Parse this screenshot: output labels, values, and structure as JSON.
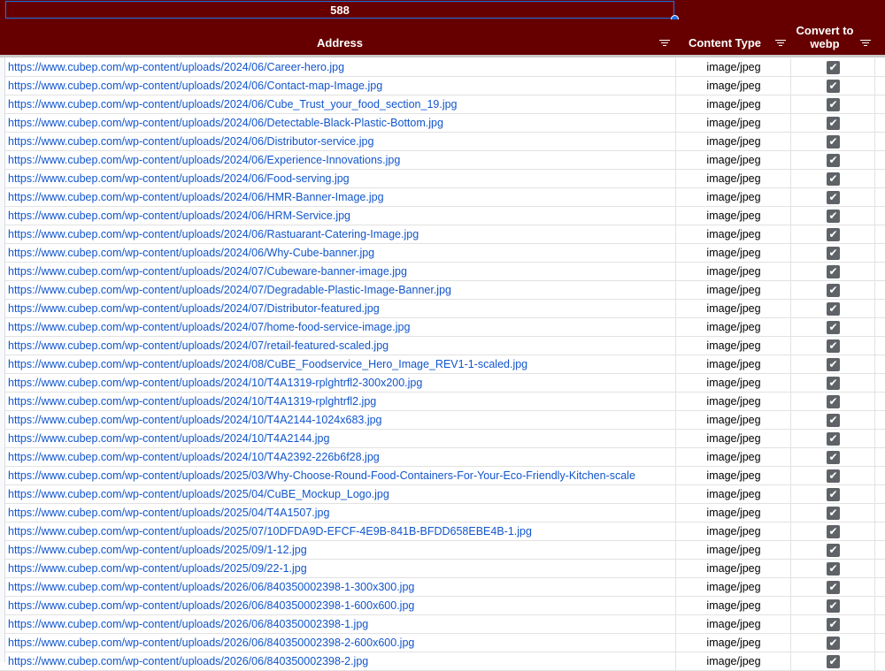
{
  "summary": {
    "count": "588"
  },
  "header": {
    "address": "Address",
    "content_type": "Content Type",
    "convert": "Convert to webp"
  },
  "rows": [
    {
      "address": "https://www.cubep.com/wp-content/uploads/2024/06/Career-hero.jpg",
      "type": "image/jpeg",
      "checked": true
    },
    {
      "address": "https://www.cubep.com/wp-content/uploads/2024/06/Contact-map-Image.jpg",
      "type": "image/jpeg",
      "checked": true
    },
    {
      "address": "https://www.cubep.com/wp-content/uploads/2024/06/Cube_Trust_your_food_section_19.jpg",
      "type": "image/jpeg",
      "checked": true
    },
    {
      "address": "https://www.cubep.com/wp-content/uploads/2024/06/Detectable-Black-Plastic-Bottom.jpg",
      "type": "image/jpeg",
      "checked": true
    },
    {
      "address": "https://www.cubep.com/wp-content/uploads/2024/06/Distributor-service.jpg",
      "type": "image/jpeg",
      "checked": true
    },
    {
      "address": "https://www.cubep.com/wp-content/uploads/2024/06/Experience-Innovations.jpg",
      "type": "image/jpeg",
      "checked": true
    },
    {
      "address": "https://www.cubep.com/wp-content/uploads/2024/06/Food-serving.jpg",
      "type": "image/jpeg",
      "checked": true
    },
    {
      "address": "https://www.cubep.com/wp-content/uploads/2024/06/HMR-Banner-Image.jpg",
      "type": "image/jpeg",
      "checked": true
    },
    {
      "address": "https://www.cubep.com/wp-content/uploads/2024/06/HRM-Service.jpg",
      "type": "image/jpeg",
      "checked": true
    },
    {
      "address": "https://www.cubep.com/wp-content/uploads/2024/06/Rastuarant-Catering-Image.jpg",
      "type": "image/jpeg",
      "checked": true
    },
    {
      "address": "https://www.cubep.com/wp-content/uploads/2024/06/Why-Cube-banner.jpg",
      "type": "image/jpeg",
      "checked": true
    },
    {
      "address": "https://www.cubep.com/wp-content/uploads/2024/07/Cubeware-banner-image.jpg",
      "type": "image/jpeg",
      "checked": true
    },
    {
      "address": "https://www.cubep.com/wp-content/uploads/2024/07/Degradable-Plastic-Image-Banner.jpg",
      "type": "image/jpeg",
      "checked": true
    },
    {
      "address": "https://www.cubep.com/wp-content/uploads/2024/07/Distributor-featured.jpg",
      "type": "image/jpeg",
      "checked": true
    },
    {
      "address": "https://www.cubep.com/wp-content/uploads/2024/07/home-food-service-image.jpg",
      "type": "image/jpeg",
      "checked": true
    },
    {
      "address": "https://www.cubep.com/wp-content/uploads/2024/07/retail-featured-scaled.jpg",
      "type": "image/jpeg",
      "checked": true
    },
    {
      "address": "https://www.cubep.com/wp-content/uploads/2024/08/CuBE_Foodservice_Hero_Image_REV1-1-scaled.jpg",
      "type": "image/jpeg",
      "checked": true
    },
    {
      "address": "https://www.cubep.com/wp-content/uploads/2024/10/T4A1319-rplghtrfl2-300x200.jpg",
      "type": "image/jpeg",
      "checked": true
    },
    {
      "address": "https://www.cubep.com/wp-content/uploads/2024/10/T4A1319-rplghtrfl2.jpg",
      "type": "image/jpeg",
      "checked": true
    },
    {
      "address": "https://www.cubep.com/wp-content/uploads/2024/10/T4A2144-1024x683.jpg",
      "type": "image/jpeg",
      "checked": true
    },
    {
      "address": "https://www.cubep.com/wp-content/uploads/2024/10/T4A2144.jpg",
      "type": "image/jpeg",
      "checked": true
    },
    {
      "address": "https://www.cubep.com/wp-content/uploads/2024/10/T4A2392-226b6f28.jpg",
      "type": "image/jpeg",
      "checked": true
    },
    {
      "address": "https://www.cubep.com/wp-content/uploads/2025/03/Why-Choose-Round-Food-Containers-For-Your-Eco-Friendly-Kitchen-scale",
      "type": "image/jpeg",
      "checked": true
    },
    {
      "address": "https://www.cubep.com/wp-content/uploads/2025/04/CuBE_Mockup_Logo.jpg",
      "type": "image/jpeg",
      "checked": true
    },
    {
      "address": "https://www.cubep.com/wp-content/uploads/2025/04/T4A1507.jpg",
      "type": "image/jpeg",
      "checked": true
    },
    {
      "address": "https://www.cubep.com/wp-content/uploads/2025/07/10DFDA9D-EFCF-4E9B-841B-BFDD658EBE4B-1.jpg",
      "type": "image/jpeg",
      "checked": true
    },
    {
      "address": "https://www.cubep.com/wp-content/uploads/2025/09/1-12.jpg",
      "type": "image/jpeg",
      "checked": true
    },
    {
      "address": "https://www.cubep.com/wp-content/uploads/2025/09/22-1.jpg",
      "type": "image/jpeg",
      "checked": true
    },
    {
      "address": "https://www.cubep.com/wp-content/uploads/2026/06/840350002398-1-300x300.jpg",
      "type": "image/jpeg",
      "checked": true
    },
    {
      "address": "https://www.cubep.com/wp-content/uploads/2026/06/840350002398-1-600x600.jpg",
      "type": "image/jpeg",
      "checked": true
    },
    {
      "address": "https://www.cubep.com/wp-content/uploads/2026/06/840350002398-1.jpg",
      "type": "image/jpeg",
      "checked": true
    },
    {
      "address": "https://www.cubep.com/wp-content/uploads/2026/06/840350002398-2-600x600.jpg",
      "type": "image/jpeg",
      "checked": true
    },
    {
      "address": "https://www.cubep.com/wp-content/uploads/2026/06/840350002398-2.jpg",
      "type": "image/jpeg",
      "checked": true
    }
  ],
  "colors": {
    "header_bg": "#660000",
    "link": "#1155cc",
    "checkbox": "#5f6368",
    "selection": "#1a73e8"
  },
  "icons": {
    "filter": "filter-icon",
    "checkbox": "checkbox-checked-icon"
  }
}
